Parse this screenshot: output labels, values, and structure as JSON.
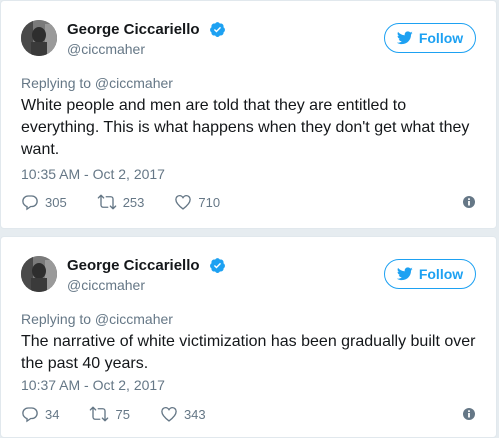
{
  "tweets": [
    {
      "author": {
        "display_name": "George Ciccariello",
        "handle": "@ciccmaher",
        "verified": true
      },
      "follow_label": "Follow",
      "replying_to": "Replying to @ciccmaher",
      "text": "White people and men are told that they are entitled to everything. This is what happens when they don't get what they want.",
      "timestamp": "10:35 AM - Oct 2, 2017",
      "replies": "305",
      "retweets": "253",
      "likes": "710"
    },
    {
      "author": {
        "display_name": "George Ciccariello",
        "handle": "@ciccmaher",
        "verified": true
      },
      "follow_label": "Follow",
      "replying_to": "Replying to @ciccmaher",
      "text": "The narrative of white victimization has been gradually built over the past 40 years.",
      "timestamp": "10:37 AM - Oct 2, 2017",
      "replies": "34",
      "retweets": "75",
      "likes": "343"
    }
  ],
  "colors": {
    "brand_blue": "#1da1f2",
    "secondary_text": "#657786",
    "primary_text": "#14171a",
    "background": "#e6ecf0"
  },
  "icons": {
    "verified": "verified-badge-icon",
    "bird": "twitter-bird-icon",
    "reply": "reply-icon",
    "retweet": "retweet-icon",
    "like": "heart-icon",
    "info": "info-icon"
  }
}
